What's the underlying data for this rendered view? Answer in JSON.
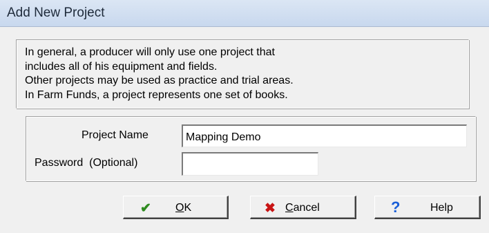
{
  "window": {
    "title": "Add New Project"
  },
  "info": {
    "lines": [
      "In general, a producer will only use one project that",
      "includes all of his equipment and fields.",
      "Other projects may be used as practice and trial areas.",
      "In Farm Funds, a project represents one set of books."
    ]
  },
  "form": {
    "project_name_label": "Project Name",
    "project_name_value": "Mapping Demo",
    "password_label": "Password  (Optional)",
    "password_value": ""
  },
  "buttons": {
    "ok": {
      "mnemonic": "O",
      "rest": "K",
      "icon": "checkmark-icon",
      "color": "#2e8b1f"
    },
    "cancel": {
      "mnemonic": "C",
      "rest": "ancel",
      "icon": "x-icon",
      "color": "#c81414"
    },
    "help": {
      "label": "Help",
      "icon": "question-icon",
      "color": "#1a5fd8"
    }
  }
}
